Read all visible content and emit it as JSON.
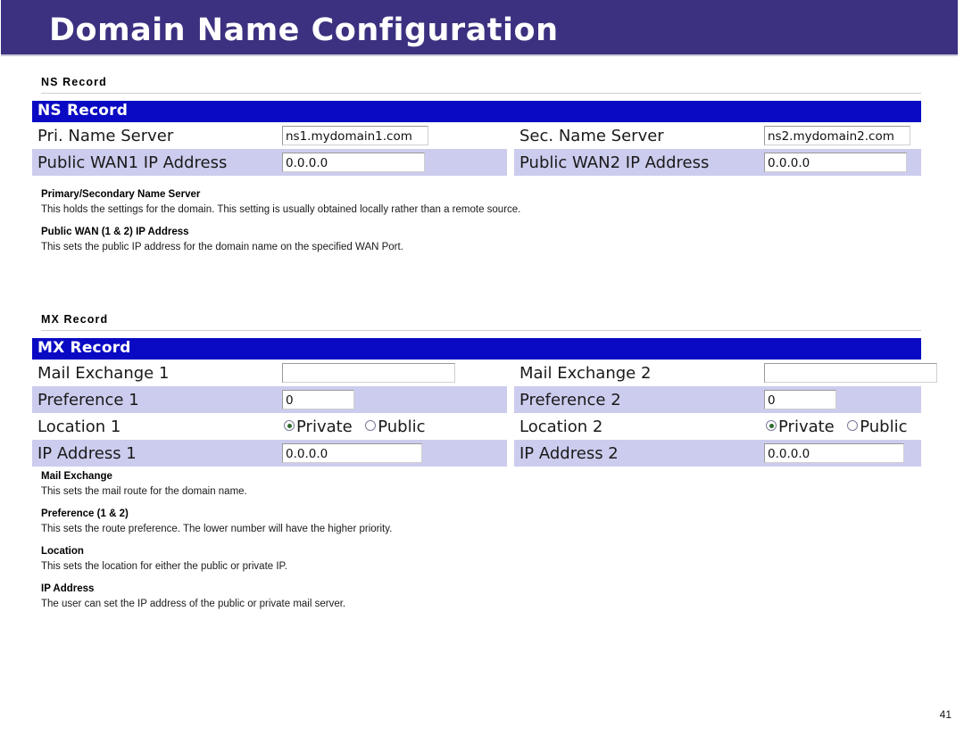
{
  "page": {
    "title": "Domain Name Configuration",
    "page_number": "41",
    "accent_purple": "#3b3180",
    "accent_blue": "#0a0ac4",
    "row_shade": "#ccccee"
  },
  "ns_section": {
    "caption": "NS Record",
    "table_title": "NS Record",
    "rows": [
      {
        "left_label": "Pri. Name Server",
        "left_value": "ns1.mydomain1.com",
        "right_label": "Sec. Name Server",
        "right_value": "ns2.mydomain2.com"
      },
      {
        "left_label": "Public WAN1 IP Address",
        "left_value": "0.0.0.0",
        "right_label": "Public WAN2 IP Address",
        "right_value": "0.0.0.0"
      }
    ],
    "help": [
      {
        "term": "Primary/Secondary Name Server",
        "desc": "This holds the settings for the domain. This setting is usually obtained locally rather than a remote source."
      },
      {
        "term": "Public WAN (1 & 2) IP Address",
        "desc": "This sets the public IP address for the domain name on the specified WAN Port."
      }
    ]
  },
  "mx_section": {
    "caption": "MX Record",
    "table_title": "MX Record",
    "rows": [
      {
        "left_label": "Mail Exchange 1",
        "left_value": "",
        "right_label": "Mail Exchange 2",
        "right_value": ""
      },
      {
        "left_label": "Preference 1",
        "left_value": "0",
        "right_label": "Preference 2",
        "right_value": "0"
      },
      {
        "left_label": "Location 1",
        "right_label": "Location 2"
      },
      {
        "left_label": "IP Address 1",
        "left_value": "0.0.0.0",
        "right_label": "IP Address 2",
        "right_value": "0.0.0.0"
      }
    ],
    "location_options": {
      "private_label": "Private",
      "public_label": "Public",
      "selected": "Private"
    },
    "help": [
      {
        "term": "Mail Exchange",
        "desc": "This sets the mail route for the domain name."
      },
      {
        "term": "Preference (1 & 2)",
        "desc": "This sets the route preference.  The lower number will have the higher priority."
      },
      {
        "term": "Location",
        "desc": "This sets the location for either the public or private IP."
      },
      {
        "term": "IP Address",
        "desc": "The user can set the IP address of the public or private mail server."
      }
    ]
  }
}
